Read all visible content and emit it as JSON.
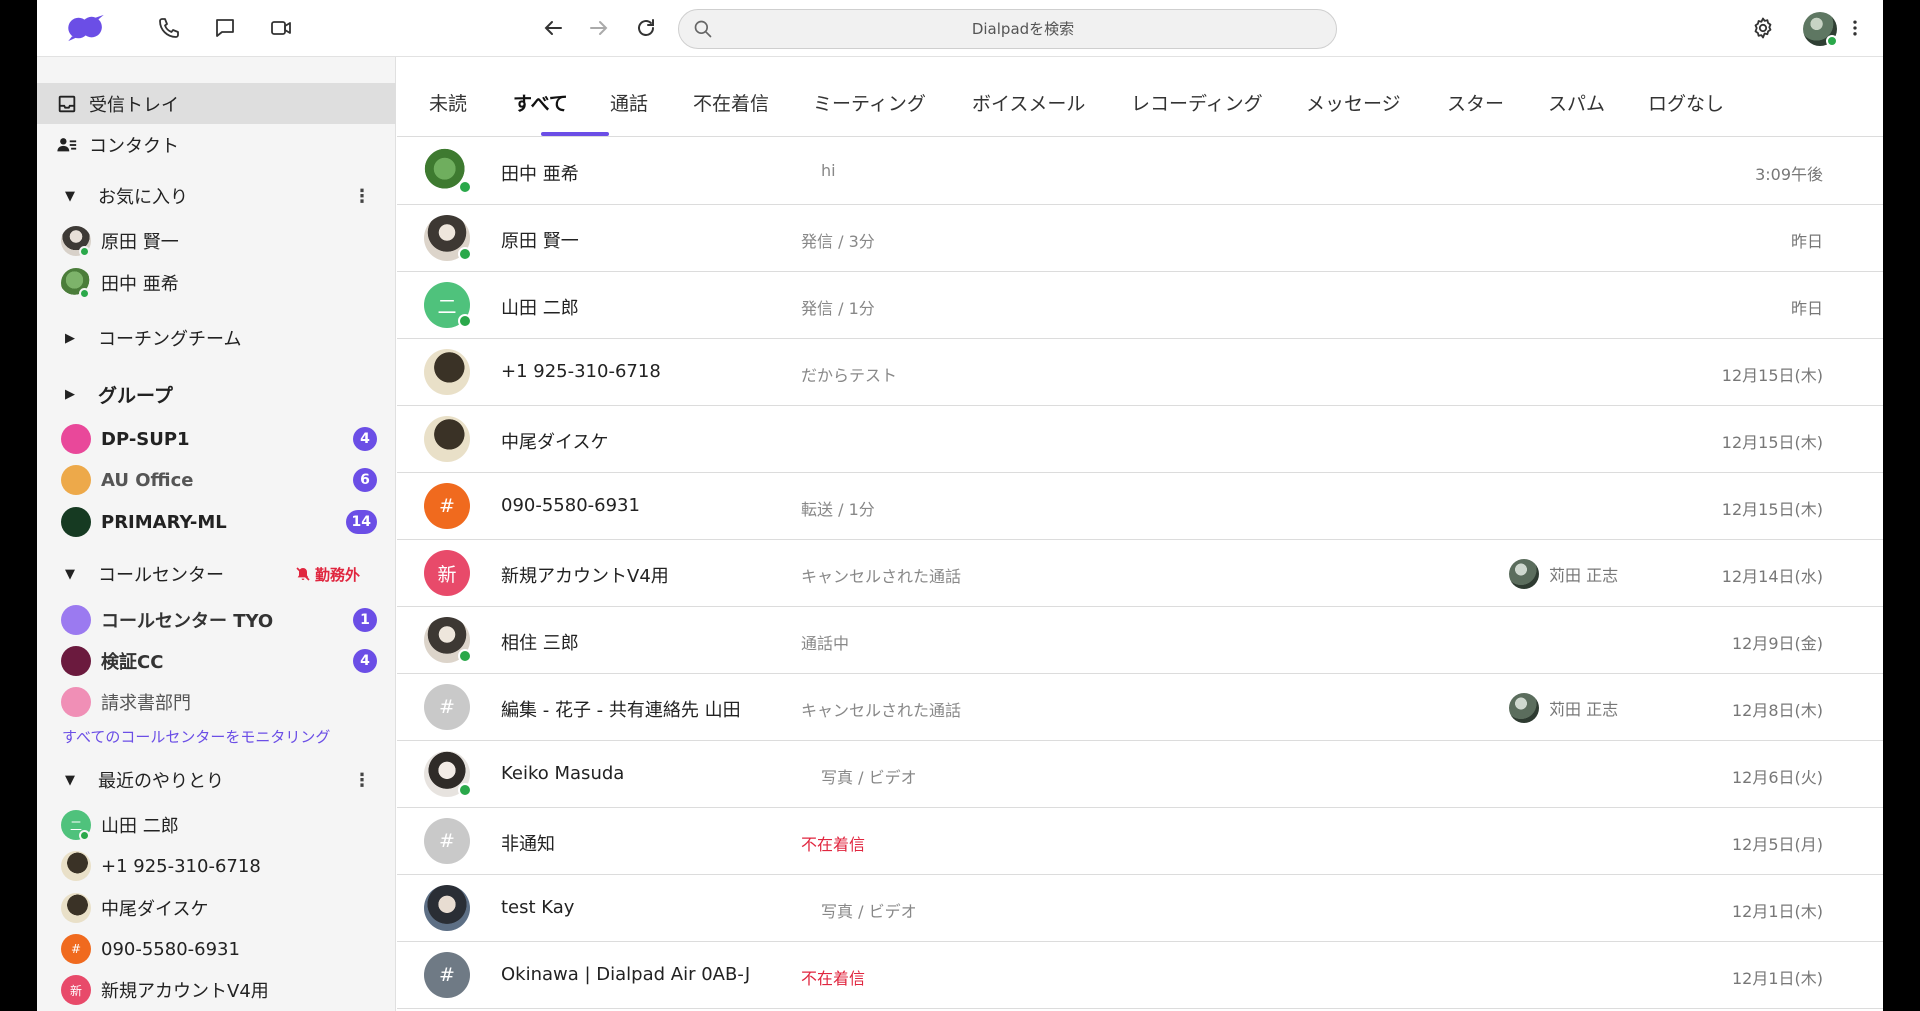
{
  "header": {
    "search_placeholder": "Dialpadを検索",
    "brand_color": "#6b4ee6"
  },
  "sidebar": {
    "inbox": "受信トレイ",
    "contacts": "コンタクト",
    "favorites": {
      "title": "お気に入り",
      "items": [
        {
          "label": "原田 賢一"
        },
        {
          "label": "田中 亜希"
        }
      ]
    },
    "coaching_team": "コーチングチーム",
    "groups": {
      "title": "グループ",
      "items": [
        {
          "label": "DP-SUP1",
          "count": "4",
          "color": "#e9489a"
        },
        {
          "label": "AU Office",
          "count": "6",
          "color": "#eda94a"
        },
        {
          "label": "PRIMARY-ML",
          "count": "14",
          "color": "#163a22"
        }
      ]
    },
    "call_centers": {
      "title": "コールセンター",
      "status": "勤務外",
      "items": [
        {
          "label": "コールセンター TYO",
          "count": "1",
          "color": "#9b7af0"
        },
        {
          "label": "検証CC",
          "count": "4",
          "color": "#6b1a3e"
        },
        {
          "label": "請求書部門",
          "count": "",
          "color": "#f08fb6"
        }
      ],
      "monitor_link": "すべてのコールセンターをモニタリング"
    },
    "recent": {
      "title": "最近のやりとり",
      "items": [
        {
          "label": "山田 二郎",
          "initial": "二",
          "color": "#4fc27c"
        },
        {
          "label": "+1 925-310-6718",
          "initial": "",
          "color": "#3a3226"
        },
        {
          "label": "中尾ダイスケ",
          "initial": "",
          "color": "#3a3226"
        },
        {
          "label": "090-5580-6931",
          "initial": "#",
          "color": "#f06a1e"
        },
        {
          "label": "新規アカウントV4用",
          "initial": "新",
          "color": "#e84a6a"
        }
      ]
    }
  },
  "tabs": [
    {
      "label": "未読"
    },
    {
      "label": "すべて"
    },
    {
      "label": "通話"
    },
    {
      "label": "不在着信"
    },
    {
      "label": "ミーティング"
    },
    {
      "label": "ボイスメール"
    },
    {
      "label": "レコーディング"
    },
    {
      "label": "メッセージ"
    },
    {
      "label": "スター"
    },
    {
      "label": "スパム"
    },
    {
      "label": "ログなし"
    }
  ],
  "active_tab": "すべて",
  "conversations": [
    {
      "name": "田中 亜希",
      "detail": "hi",
      "assignee": "",
      "time": "3:09午後"
    },
    {
      "name": "原田 賢一",
      "detail": "発信 / 3分",
      "assignee": "",
      "time": "昨日"
    },
    {
      "name": "山田 二郎",
      "detail": "発信 / 1分",
      "assignee": "",
      "time": "昨日",
      "initial": "二"
    },
    {
      "name": "+1 925-310-6718",
      "detail": "だからテスト",
      "assignee": "",
      "time": "12月15日(木)"
    },
    {
      "name": "中尾ダイスケ",
      "detail": "",
      "assignee": "",
      "time": "12月15日(木)"
    },
    {
      "name": "090-5580-6931",
      "detail": "転送 / 1分",
      "assignee": "",
      "time": "12月15日(木)",
      "initial": "#"
    },
    {
      "name": "新規アカウントV4用",
      "detail": "キャンセルされた通話",
      "assignee": "苅田 正志",
      "time": "12月14日(水)",
      "initial": "新"
    },
    {
      "name": "相住 三郎",
      "detail": "通話中",
      "assignee": "",
      "time": "12月9日(金)"
    },
    {
      "name": "編集 - 花子 - 共有連絡先 山田",
      "detail": "キャンセルされた通話",
      "assignee": "苅田 正志",
      "time": "12月8日(木)",
      "initial": "#"
    },
    {
      "name": "Keiko Masuda",
      "detail": "写真 / ビデオ",
      "assignee": "",
      "time": "12月6日(火)"
    },
    {
      "name": "非通知",
      "detail": "不在着信",
      "assignee": "",
      "time": "12月5日(月)",
      "initial": "#"
    },
    {
      "name": "test Kay",
      "detail": "写真 / ビデオ",
      "assignee": "",
      "time": "12月1日(木)"
    },
    {
      "name": "Okinawa | Dialpad Air 0AB-J",
      "detail": "不在着信",
      "assignee": "",
      "time": "12月1日(木)",
      "initial": "#"
    }
  ]
}
